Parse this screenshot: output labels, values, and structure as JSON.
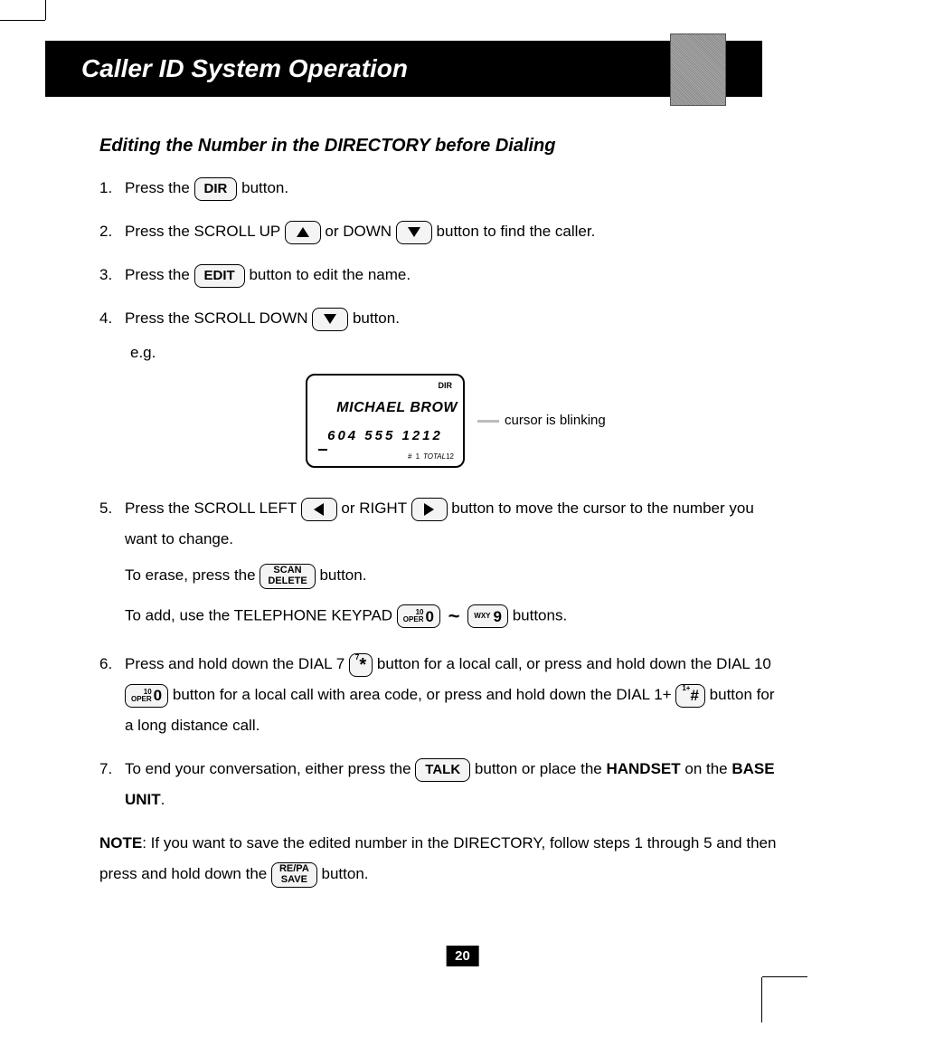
{
  "header": {
    "title": "Caller ID System Operation"
  },
  "subheading": "Editing the Number in the DIRECTORY before Dialing",
  "steps": {
    "s1": {
      "num": "1.",
      "t1": "Press the ",
      "t2": " button."
    },
    "s2": {
      "num": "2.",
      "t1": "Press the SCROLL UP ",
      "t2": " or DOWN ",
      "t3": " button to find the caller."
    },
    "s3": {
      "num": "3.",
      "t1": "Press the ",
      "t2": " button to edit the name."
    },
    "s4": {
      "num": "4.",
      "t1": "Press the SCROLL DOWN ",
      "t2": " button.",
      "eg": "e.g."
    },
    "s5": {
      "num": "5.",
      "t1": "Press the SCROLL LEFT ",
      "t2": " or RIGHT ",
      "t3": " button to move the cursor to the number you want to change.",
      "erase1": "To erase, press the ",
      "erase2": " button.",
      "add1": "To add, use the TELEPHONE KEYPAD ",
      "add2": " buttons."
    },
    "s6": {
      "num": "6.",
      "t1": "Press and hold down the DIAL 7 ",
      "t2": " button for a local call, or press and hold down the DIAL 10 ",
      "t3": " button for a local call with area code, or press and hold down the DIAL 1+ ",
      "t4": " button for a long distance call."
    },
    "s7": {
      "num": "7.",
      "t1": "To end your conversation, either press the ",
      "t2": " button or place the ",
      "handset": "HANDSET",
      "t3": " on the ",
      "base": "BASE UNIT",
      "t4": "."
    }
  },
  "note": {
    "label": "NOTE",
    "t1": ": If you want to save the edited number in the DIRECTORY, follow steps 1 through 5 and then press and hold down the ",
    "t2": " button."
  },
  "buttons": {
    "dir": "DIR",
    "edit": "EDIT",
    "talk": "TALK",
    "scan": "SCAN",
    "delete": "DELETE",
    "repa": "RE/PA",
    "save": "SAVE",
    "tel0_sup1": "10",
    "tel0_sup2": "OPER",
    "tel0_big": "0",
    "tel9_letters": "WXY",
    "tel9_big": "9",
    "star_sup": "7",
    "star_big": "*",
    "hash_sup": "1+",
    "hash_big": "#",
    "tilde": "~"
  },
  "lcd": {
    "top": "DIR",
    "name": "MICHAEL BROW",
    "number": "604 555 1212",
    "hash": "#",
    "idx": "1",
    "total_label": "TOTAL",
    "total_val": "12",
    "callout": "cursor is blinking"
  },
  "page_number": "20"
}
